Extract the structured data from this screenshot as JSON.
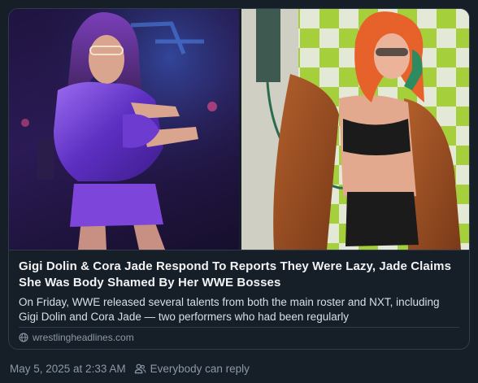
{
  "link_card": {
    "headline": "Gigi Dolin & Cora Jade Respond To Reports They Were Lazy, Jade Claims She Was Body Shamed By Her WWE Bosses",
    "description": "On Friday, WWE released several talents from both the main roster and NXT, including Gigi Dolin and Cora Jade — two performers who had been regularly",
    "source_domain": "wrestlingheadlines.com",
    "source_icon": "globe-icon",
    "images": [
      {
        "subject": "performer in shiny purple jacket pointing"
      },
      {
        "subject": "performer with orange hair holding green telephone"
      }
    ]
  },
  "post_meta": {
    "timestamp": "May 5, 2025 at 2:33 AM",
    "reply_setting": "Everybody can reply",
    "reply_icon": "people-icon"
  },
  "colors": {
    "background": "#161e27",
    "border": "#2e3b4a",
    "headline_text": "#f1f3f5",
    "body_text": "#d9dfe6",
    "muted_text": "#8b99a8"
  }
}
